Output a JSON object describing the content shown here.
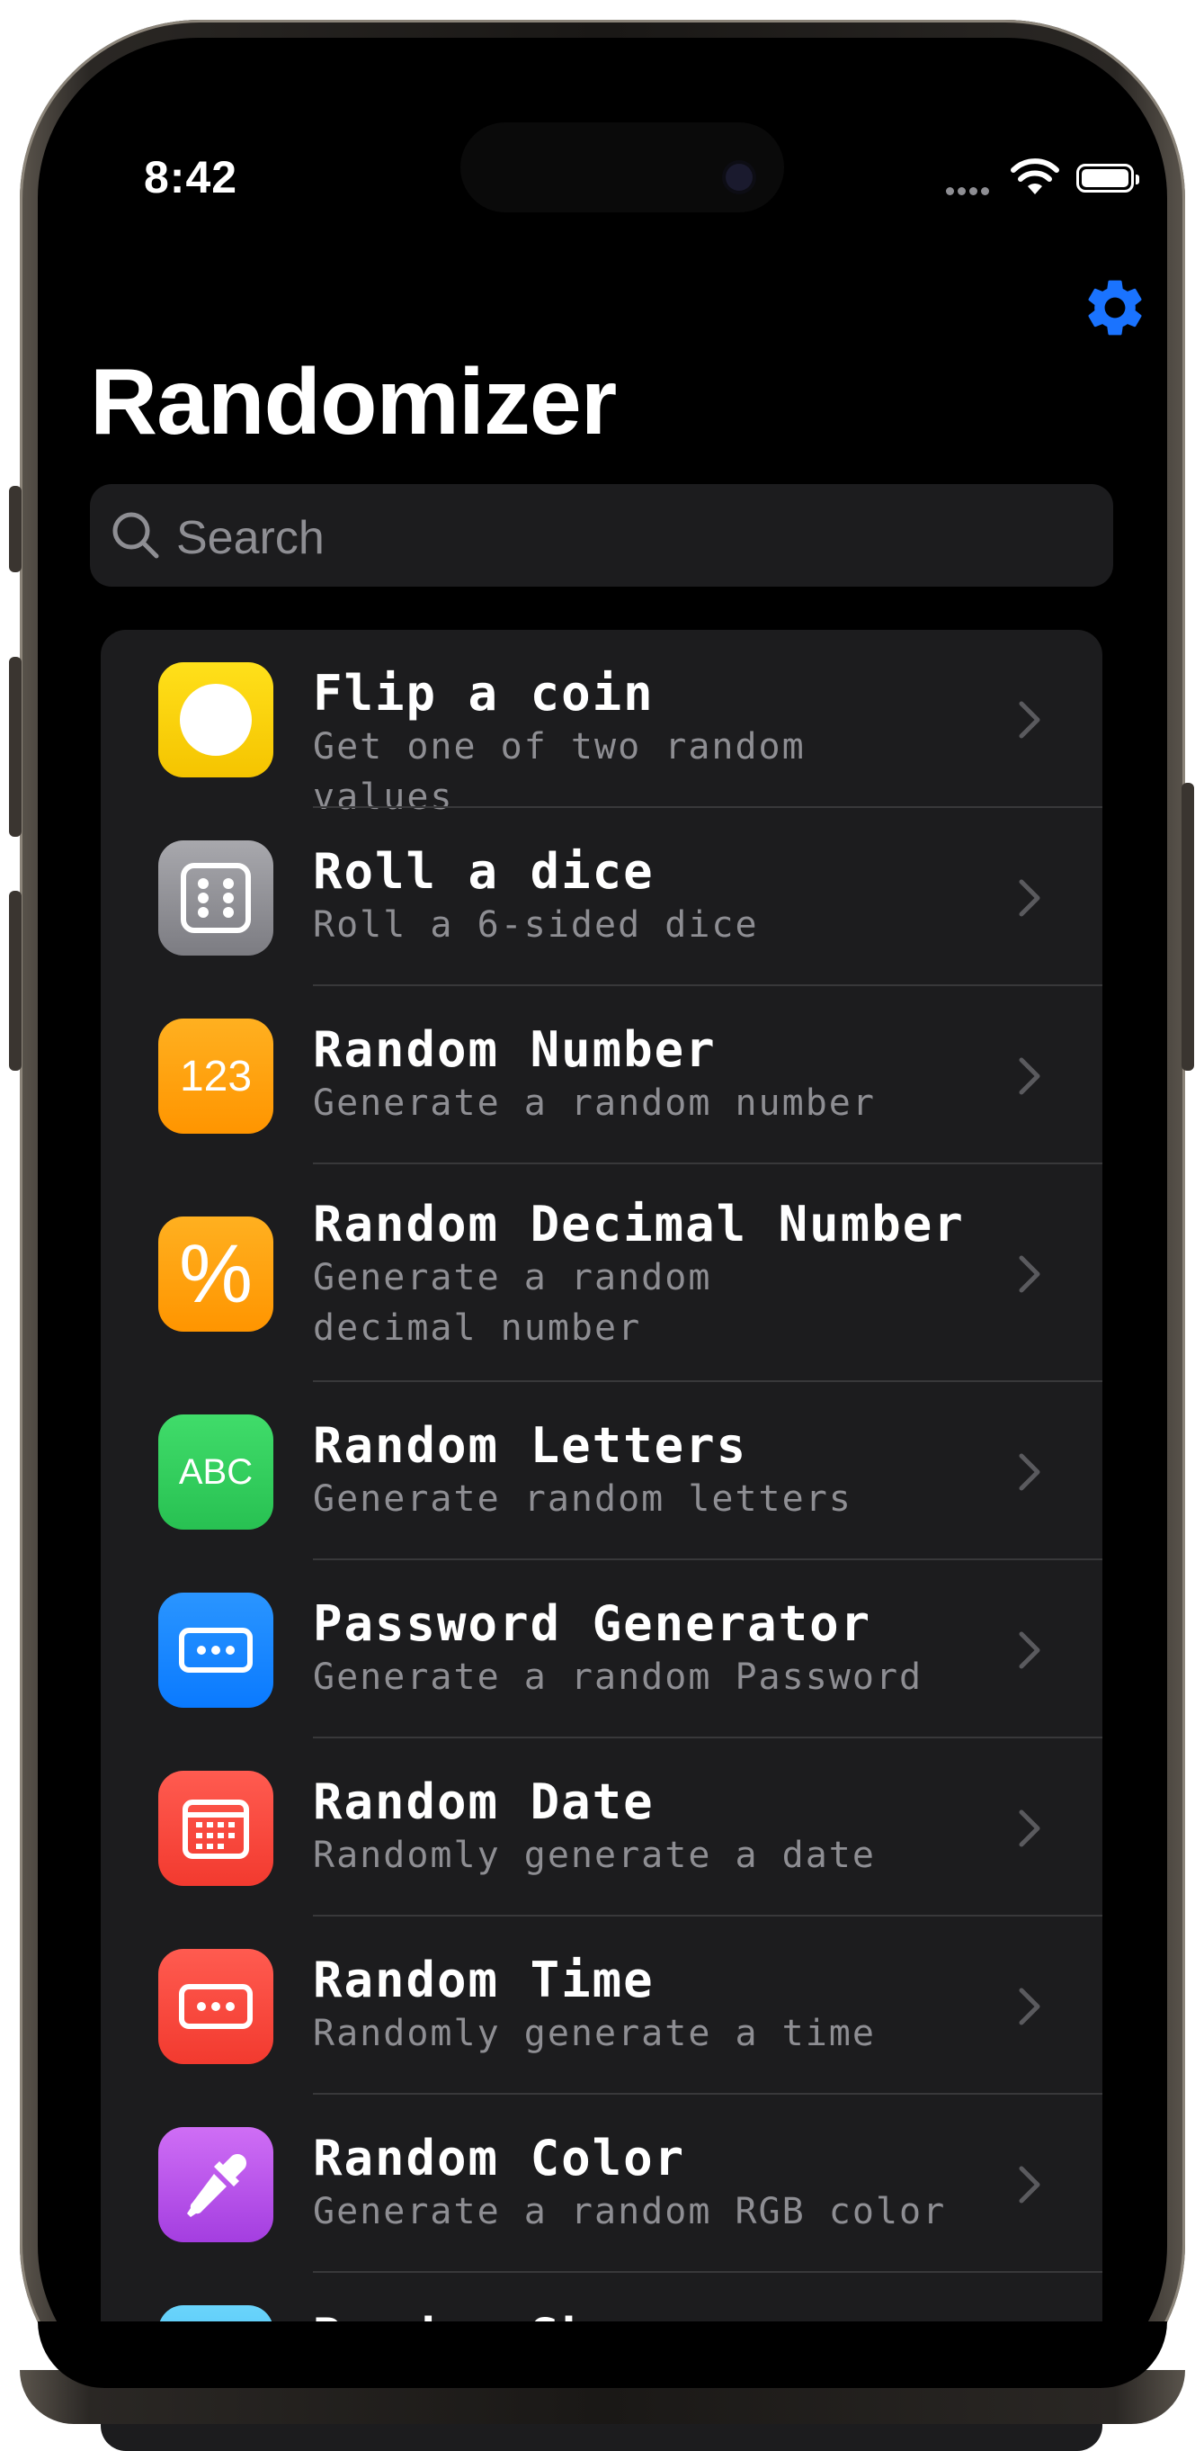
{
  "status_bar": {
    "time": "8:42",
    "signal_icon": "signal-dots-icon",
    "wifi_icon": "wifi-icon",
    "battery_icon": "battery-icon",
    "battery_level": 1.0
  },
  "nav": {
    "settings_icon": "gear-icon",
    "accent": "#1a73ff",
    "title": "Randomizer"
  },
  "search": {
    "placeholder": "Search",
    "icon": "search-icon"
  },
  "items": [
    {
      "title": "Flip a coin",
      "subtitle": "Get one of two random values",
      "icon": "coin-icon",
      "color": "#ffd60a"
    },
    {
      "title": "Roll a dice",
      "subtitle": "Roll a 6-sided dice",
      "icon": "dice-icon",
      "color": "#8e8e93"
    },
    {
      "title": "Random Number",
      "subtitle": "Generate a random number",
      "icon": "number-icon",
      "icon_text": "123",
      "color": "#ff9f0a"
    },
    {
      "title": "Random Decimal Number",
      "subtitle": "Generate a random",
      "subtitle2": "decimal number",
      "icon": "percent-icon",
      "icon_text": "%",
      "color": "#ff9f0a"
    },
    {
      "title": "Random Letters",
      "subtitle": "Generate random letters",
      "icon": "letters-icon",
      "icon_text": "ABC",
      "color": "#30d158"
    },
    {
      "title": "Password Generator",
      "subtitle": "Generate a random Password",
      "icon": "password-icon",
      "color": "#0a84ff"
    },
    {
      "title": "Random Date",
      "subtitle": "Randomly generate a date",
      "icon": "calendar-icon",
      "color": "#ff453a"
    },
    {
      "title": "Random Time",
      "subtitle": "Randomly generate a time",
      "icon": "time-icon",
      "color": "#ff453a"
    },
    {
      "title": "Random Color",
      "subtitle": "Generate a random RGB color",
      "icon": "eyedropper-icon",
      "color": "#bf5af2"
    },
    {
      "title": "Random Shape",
      "subtitle": "",
      "icon": "triangle-icon",
      "color": "#5ac8fa"
    }
  ]
}
